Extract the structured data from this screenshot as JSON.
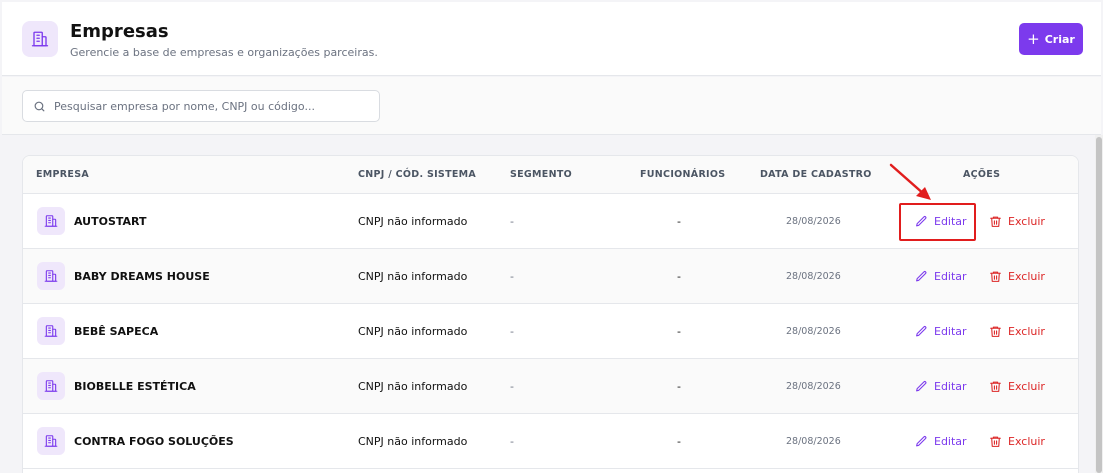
{
  "header": {
    "title": "Empresas",
    "subtitle": "Gerencie a base de empresas e organizações parceiras.",
    "create_label": "Criar"
  },
  "search": {
    "placeholder": "Pesquisar empresa por nome, CNPJ ou código..."
  },
  "table": {
    "columns": [
      "EMPRESA",
      "CNPJ / CÓD. SISTEMA",
      "SEGMENTO",
      "FUNCIONÁRIOS",
      "DATA DE CADASTRO",
      "AÇÕES"
    ],
    "rows": [
      {
        "name": "AUTOSTART",
        "cnpj": "CNPJ não informado",
        "segment": "-",
        "employees": "-",
        "date": "28/08/2026",
        "edit": "Editar",
        "delete": "Excluir"
      },
      {
        "name": "BABY DREAMS HOUSE",
        "cnpj": "CNPJ não informado",
        "segment": "-",
        "employees": "-",
        "date": "28/08/2026",
        "edit": "Editar",
        "delete": "Excluir"
      },
      {
        "name": "BEBÊ SAPECA",
        "cnpj": "CNPJ não informado",
        "segment": "-",
        "employees": "-",
        "date": "28/08/2026",
        "edit": "Editar",
        "delete": "Excluir"
      },
      {
        "name": "BIOBELLE ESTÉTICA",
        "cnpj": "CNPJ não informado",
        "segment": "-",
        "employees": "-",
        "date": "28/08/2026",
        "edit": "Editar",
        "delete": "Excluir"
      },
      {
        "name": "CONTRA FOGO SOLUÇÕES",
        "cnpj": "CNPJ não informado",
        "segment": "-",
        "employees": "-",
        "date": "28/08/2026",
        "edit": "Editar",
        "delete": "Excluir"
      }
    ]
  },
  "colors": {
    "accent": "#7c3aed",
    "danger": "#dc2626",
    "annotation": "#e11d1d"
  },
  "icons": {
    "header": "building-icon",
    "create": "plus-icon",
    "search": "search-icon",
    "company": "building-icon",
    "edit": "pencil-icon",
    "delete": "trash-icon"
  }
}
